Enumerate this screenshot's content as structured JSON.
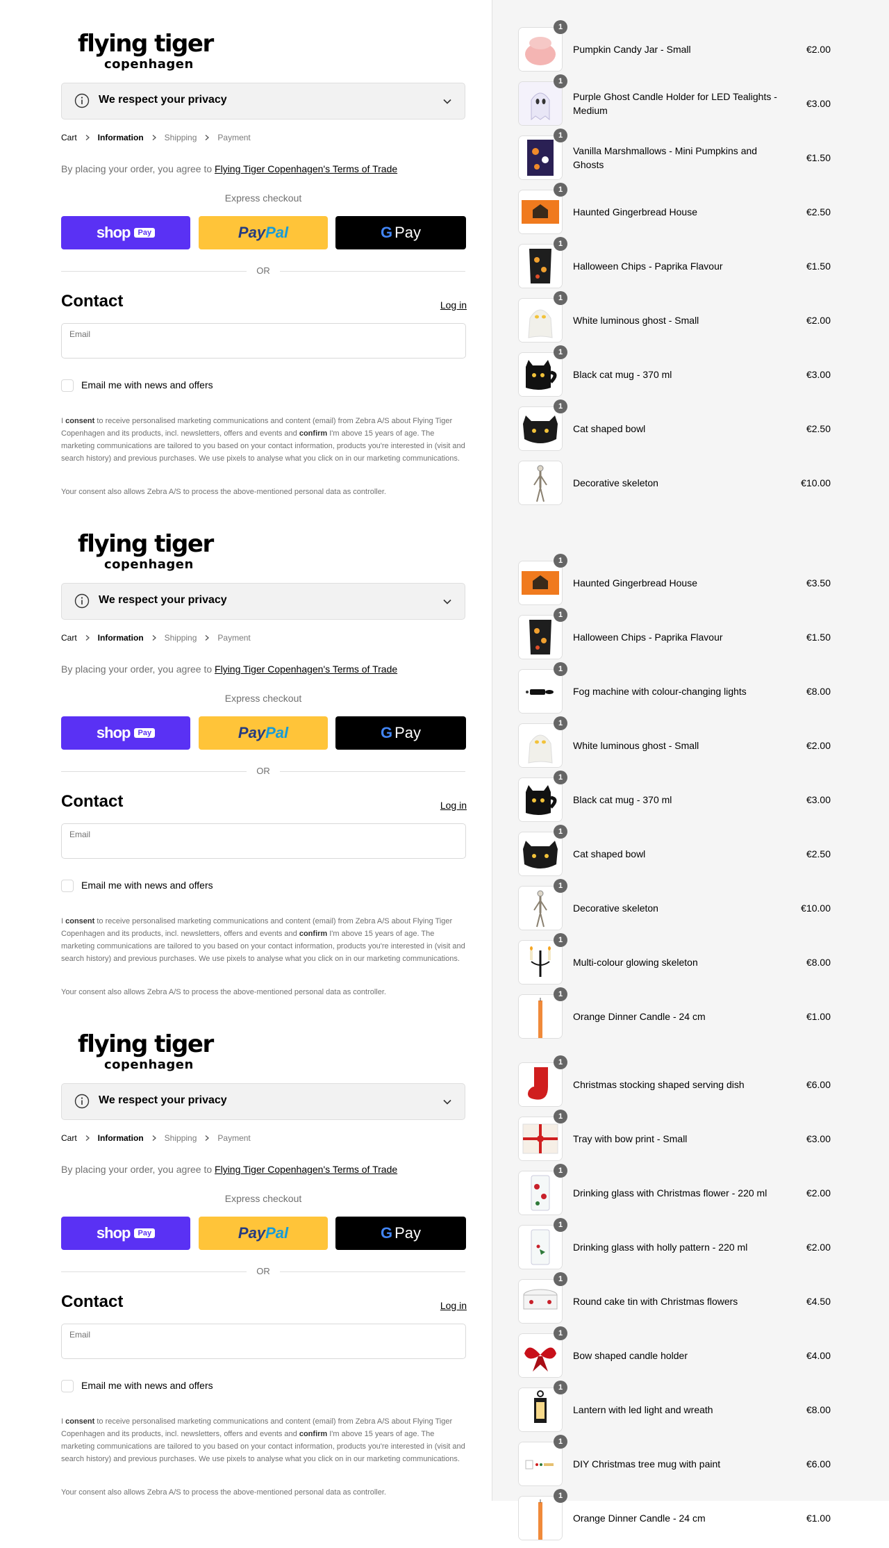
{
  "brand": {
    "logo_line1": "flying tiger",
    "logo_line2": "copenhagen"
  },
  "privacy": {
    "label": "We respect your privacy"
  },
  "breadcrumb": {
    "cart": "Cart",
    "information": "Information",
    "shipping": "Shipping",
    "payment": "Payment"
  },
  "terms": {
    "prefix": "By placing your order, you agree to ",
    "link": "Flying Tiger Copenhagen's Terms of Trade"
  },
  "express": {
    "label": "Express checkout",
    "shop": "shop",
    "shop_badge": "Pay",
    "paypal_a": "Pay",
    "paypal_b": "Pal",
    "gpay_g": "G",
    "gpay": "Pay",
    "or": "OR"
  },
  "contact": {
    "heading": "Contact",
    "login": "Log in",
    "email_label": "Email",
    "email_value": "",
    "newsletter": "Email me with news and offers"
  },
  "consent": {
    "p1_a": "I ",
    "p1_b": "consent",
    "p1_c": " to receive personalised marketing communications and content (email) from Zebra A/S about Flying Tiger Copenhagen and its products, incl. newsletters, offers and events and ",
    "p1_d": "confirm",
    "p1_e": " I'm above 15 years of age. The marketing communications are tailored to you based on your contact information, products you're interested in (visit and search history) and previous purchases. We use pixels to analyse what you click on in our marketing communications.",
    "p2": "Your consent also allows Zebra A/S to process the above-mentioned personal data as controller."
  },
  "cart_items": [
    {
      "name": "Pumpkin Candy Jar - Small",
      "price": "€2.00",
      "qty": "1",
      "icon": "pumpkin-jar-icon"
    },
    {
      "name": "Purple Ghost Candle Holder for LED Tealights - Medium",
      "price": "€3.00",
      "qty": "1",
      "icon": "ghost-candle-holder-icon"
    },
    {
      "name": "Vanilla Marshmallows - Mini Pumpkins and Ghosts",
      "price": "€1.50",
      "qty": "1",
      "icon": "marshmallow-bag-icon"
    },
    {
      "name": "Haunted Gingerbread House",
      "price": "€2.50",
      "qty": "1",
      "icon": "gingerbread-box-icon"
    },
    {
      "name": "Halloween Chips - Paprika Flavour",
      "price": "€1.50",
      "qty": "1",
      "icon": "chips-bag-icon"
    },
    {
      "name": "White luminous ghost - Small",
      "price": "€2.00",
      "qty": "1",
      "icon": "white-ghost-icon"
    },
    {
      "name": "Black cat mug - 370 ml",
      "price": "€3.00",
      "qty": "1",
      "icon": "cat-mug-icon"
    },
    {
      "name": "Cat shaped bowl",
      "price": "€2.50",
      "qty": "1",
      "icon": "cat-bowl-icon"
    },
    {
      "name": "Decorative skeleton",
      "price": "€10.00",
      "qty": "",
      "icon": "skeleton-icon"
    },
    {
      "name": "Haunted Gingerbread House",
      "price": "€3.50",
      "qty": "1",
      "icon": "gingerbread-box-icon"
    },
    {
      "name": "Halloween Chips - Paprika Flavour",
      "price": "€1.50",
      "qty": "1",
      "icon": "chips-bag-icon"
    },
    {
      "name": "Fog machine with colour-changing lights",
      "price": "€8.00",
      "qty": "1",
      "icon": "fog-machine-icon"
    },
    {
      "name": "White luminous ghost - Small",
      "price": "€2.00",
      "qty": "1",
      "icon": "white-ghost-icon"
    },
    {
      "name": "Black cat mug - 370 ml",
      "price": "€3.00",
      "qty": "1",
      "icon": "cat-mug-icon"
    },
    {
      "name": "Cat shaped bowl",
      "price": "€2.50",
      "qty": "1",
      "icon": "cat-bowl-icon"
    },
    {
      "name": "Decorative skeleton",
      "price": "€10.00",
      "qty": "1",
      "icon": "skeleton-icon"
    },
    {
      "name": "Multi-colour glowing skeleton",
      "price": "€8.00",
      "qty": "1",
      "icon": "candelabra-skeleton-icon"
    },
    {
      "name": "Orange Dinner Candle - 24 cm",
      "price": "€1.00",
      "qty": "1",
      "icon": "orange-candle-icon"
    },
    {
      "name": "Christmas stocking shaped serving dish",
      "price": "€6.00",
      "qty": "1",
      "icon": "stocking-dish-icon"
    },
    {
      "name": "Tray with bow print - Small",
      "price": "€3.00",
      "qty": "1",
      "icon": "bow-tray-icon"
    },
    {
      "name": "Drinking glass with Christmas flower - 220 ml",
      "price": "€2.00",
      "qty": "1",
      "icon": "flower-glass-icon"
    },
    {
      "name": "Drinking glass with holly pattern - 220 ml",
      "price": "€2.00",
      "qty": "1",
      "icon": "holly-glass-icon"
    },
    {
      "name": "Round cake tin with Christmas flowers",
      "price": "€4.50",
      "qty": "1",
      "icon": "cake-tin-icon"
    },
    {
      "name": "Bow shaped candle holder",
      "price": "€4.00",
      "qty": "1",
      "icon": "bow-candle-holder-icon"
    },
    {
      "name": "Lantern with led light and wreath",
      "price": "€8.00",
      "qty": "1",
      "icon": "lantern-icon"
    },
    {
      "name": "DIY Christmas tree mug with paint",
      "price": "€6.00",
      "qty": "1",
      "icon": "diy-mug-icon"
    },
    {
      "name": "Orange Dinner Candle - 24 cm",
      "price": "€1.00",
      "qty": "1",
      "icon": "orange-candle-icon"
    }
  ],
  "colors": {
    "shop": "#5a31f4",
    "paypal": "#ffc439",
    "gpay": "#000000",
    "sidebar": "#f5f5f5"
  }
}
